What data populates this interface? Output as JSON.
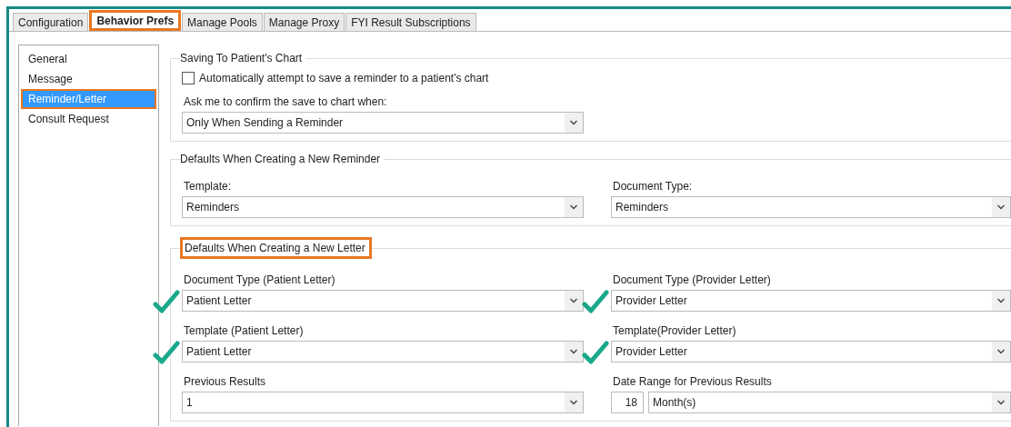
{
  "tabs": [
    {
      "label": "Configuration",
      "selected": false,
      "highlighted": false
    },
    {
      "label": "Behavior Prefs",
      "selected": true,
      "highlighted": true
    },
    {
      "label": "Manage Pools",
      "selected": false,
      "highlighted": false
    },
    {
      "label": "Manage Proxy",
      "selected": false,
      "highlighted": false
    },
    {
      "label": "FYI Result Subscriptions",
      "selected": false,
      "highlighted": false
    }
  ],
  "sidebar": {
    "items": [
      {
        "label": "General",
        "selected": false,
        "highlighted": false
      },
      {
        "label": "Message",
        "selected": false,
        "highlighted": false
      },
      {
        "label": "Reminder/Letter",
        "selected": true,
        "highlighted": true
      },
      {
        "label": "Consult Request",
        "selected": false,
        "highlighted": false
      }
    ]
  },
  "saving": {
    "title": "Saving To Patient's Chart",
    "checkbox": {
      "label": "Automatically attempt to save a reminder to a patient's chart",
      "checked": false
    },
    "confirm_label": "Ask me to confirm the save to chart when:",
    "confirm_value": "Only When Sending a Reminder"
  },
  "reminder": {
    "title": "Defaults When Creating a New Reminder",
    "fields": [
      {
        "label": "Template:",
        "value": "Reminders"
      },
      {
        "label": "Document Type:",
        "value": "Reminders"
      }
    ]
  },
  "letter": {
    "title": "Defaults When Creating a New Letter",
    "highlighted": true,
    "fields": [
      {
        "label": "Document Type (Patient Letter)",
        "value": "Patient Letter",
        "ticked": true
      },
      {
        "label": "Document Type (Provider Letter)",
        "value": "Provider Letter",
        "ticked": true
      },
      {
        "label": "Template (Patient Letter)",
        "value": "Patient Letter",
        "ticked": true
      },
      {
        "label": "Template(Provider Letter)",
        "value": "Provider Letter",
        "ticked": true
      }
    ],
    "previous_results": {
      "label": "Previous Results",
      "value": "1"
    },
    "date_range": {
      "label": "Date Range for Previous Results",
      "number": "18",
      "unit": "Month(s)"
    }
  }
}
